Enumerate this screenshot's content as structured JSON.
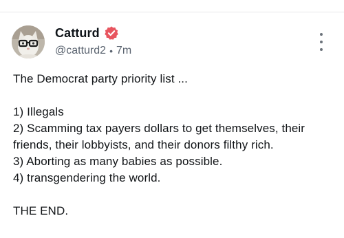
{
  "post": {
    "author": {
      "display_name": "Catturd",
      "handle": "@catturd2",
      "verified_icon": "verified-badge-icon",
      "avatar": "cat-with-glasses-avatar"
    },
    "timestamp": "7m",
    "separator": "•",
    "more_icon": "more-vertical-icon",
    "text": {
      "intro": "The Democrat party priority list ...",
      "items": [
        "1) Illegals",
        "2) Scamming tax payers dollars to get themselves, their friends, their lobbyists, and their donors filthy rich.",
        "3) Aborting as many babies as possible.",
        "4) transgendering the world."
      ],
      "closing": "THE END."
    }
  },
  "colors": {
    "verified_badge": "#e8555f",
    "secondary_text": "#5b6470",
    "divider": "#e8e8ea"
  }
}
